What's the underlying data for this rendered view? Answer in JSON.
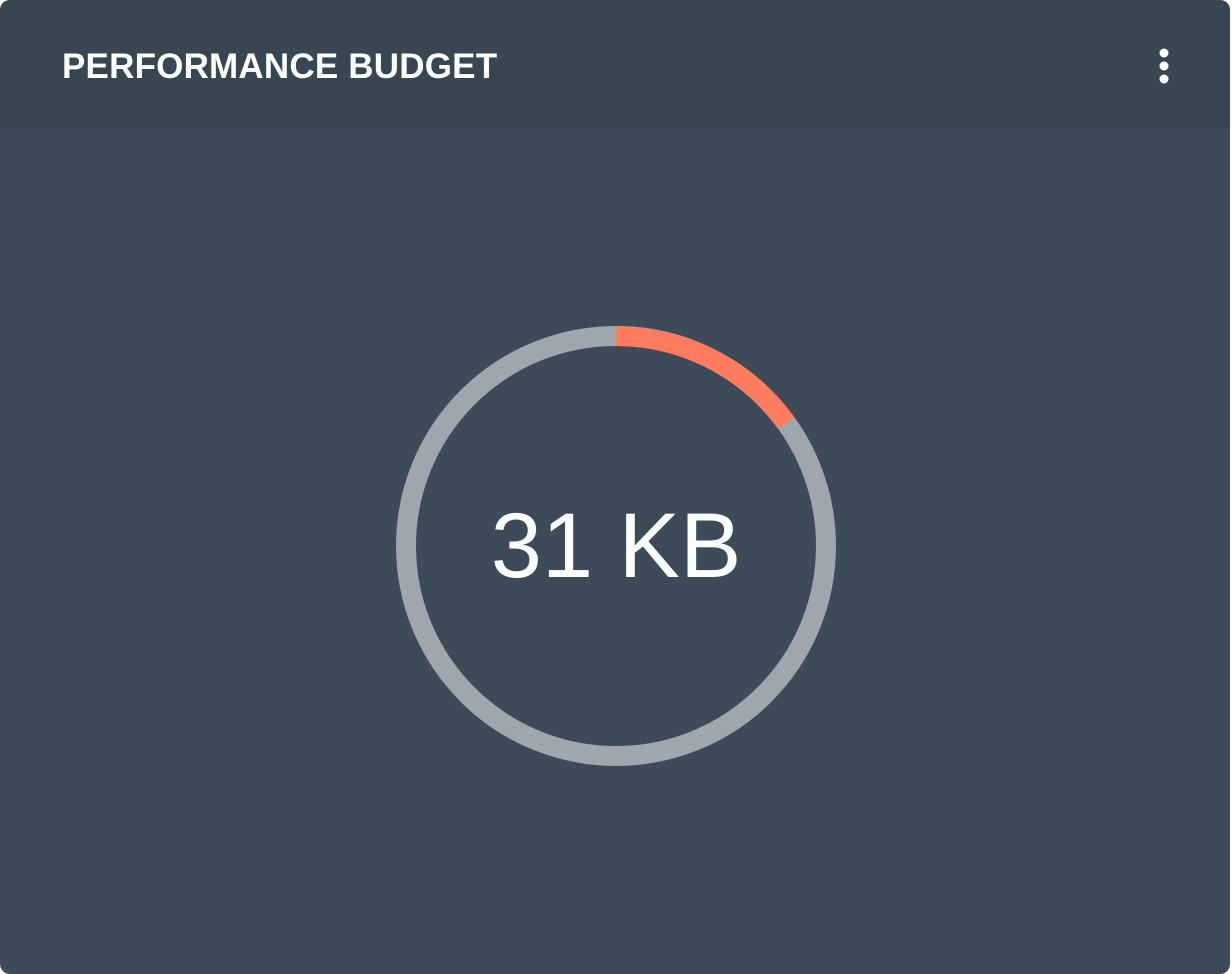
{
  "widget": {
    "title": "PERFORMANCE BUDGET",
    "menu_icon": "more-vertical-icon",
    "gauge": {
      "value_label": "31 KB",
      "used_fraction": 0.15
    }
  },
  "colors": {
    "card_background": "#3d4b59",
    "header_background": "#374651",
    "gauge_track": "#9fa6ad",
    "gauge_progress": "#ff7c5e",
    "text": "#ffffff"
  }
}
